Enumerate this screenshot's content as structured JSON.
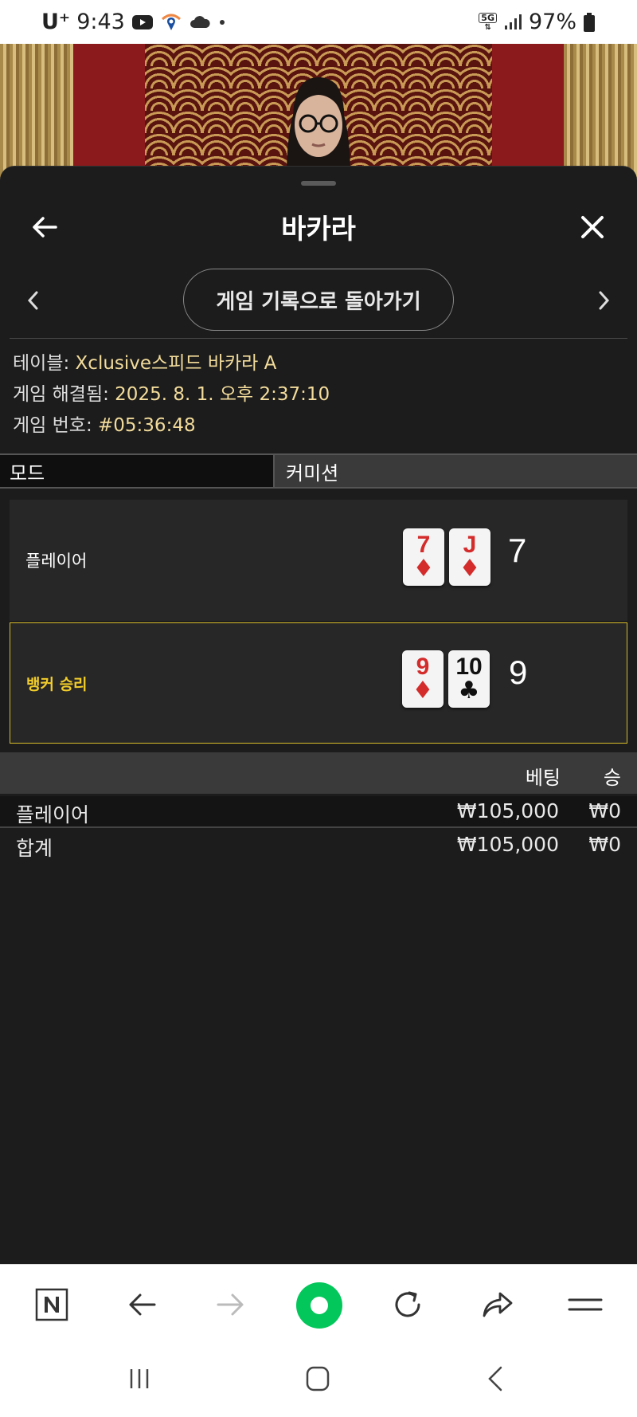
{
  "status_bar": {
    "carrier": "U⁺",
    "time": "9:43",
    "network": "5G",
    "battery": "97%"
  },
  "header": {
    "title": "바카라"
  },
  "nav": {
    "return_label": "게임 기록으로 돌아가기"
  },
  "info": {
    "table_label": "테이블: ",
    "table_value": "Xclusive스피드 바카라 A",
    "resolved_label": "게임 해결됨: ",
    "resolved_value": "2025. 8. 1. 오후 2:37:10",
    "game_no_label": "게임 번호: ",
    "game_no_value": "#05:36:48"
  },
  "mode_row": {
    "mode": "모드",
    "commission": "커미션"
  },
  "hands": {
    "player": {
      "label": "플레이어",
      "cards": [
        {
          "rank": "7",
          "suit": "♦",
          "color": "red"
        },
        {
          "rank": "J",
          "suit": "♦",
          "color": "red"
        }
      ],
      "score": "7"
    },
    "banker": {
      "label": "뱅커 승리",
      "cards": [
        {
          "rank": "9",
          "suit": "♦",
          "color": "red"
        },
        {
          "rank": "10",
          "suit": "♣",
          "color": "black"
        }
      ],
      "score": "9"
    }
  },
  "bets": {
    "col_bet": "베팅",
    "col_win": "승",
    "rows": [
      {
        "name": "플레이어",
        "bet": "₩105,000",
        "win": "₩0"
      },
      {
        "name": "합계",
        "bet": "₩105,000",
        "win": "₩0"
      }
    ]
  },
  "colors": {
    "accent_yellow": "#d7b92a",
    "info_value": "#f3dc9b",
    "naver_green": "#03c75a"
  },
  "browser_icons": [
    "naver-n-icon",
    "back-arrow-icon",
    "forward-arrow-icon",
    "home-green-icon",
    "refresh-icon",
    "share-icon",
    "menu-icon"
  ]
}
